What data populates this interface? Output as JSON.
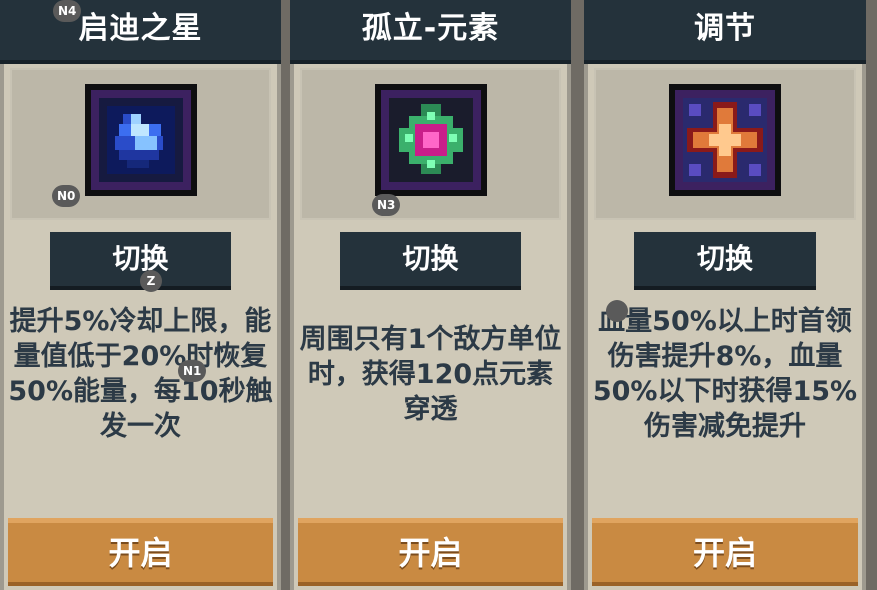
{
  "cards": [
    {
      "title": "启迪之星",
      "switch_label": "切换",
      "description": "提升5%冷却上限，能量值低于20%时恢复50%能量，每10秒触发一次",
      "open_label": "开启",
      "icon": "blue-crystal-icon"
    },
    {
      "title": "孤立-元素",
      "switch_label": "切换",
      "description": "周围只有1个敌方单位时，获得120点元素穿透",
      "open_label": "开启",
      "icon": "green-pink-gem-icon"
    },
    {
      "title": "调节",
      "switch_label": "切换",
      "description": "血量50%以上时首领伤害提升8%，血量50%以下时获得15%伤害减免提升",
      "open_label": "开启",
      "icon": "orange-star-icon"
    }
  ],
  "badges": {
    "n4": "N4",
    "n0": "N0",
    "n3": "N3",
    "z": "Z",
    "n1": "N1"
  },
  "colors": {
    "title_bar": "#24323b",
    "card_bg": "#cfc9b8",
    "open_button": "#c98a42",
    "description_text": "#2c3a46"
  }
}
